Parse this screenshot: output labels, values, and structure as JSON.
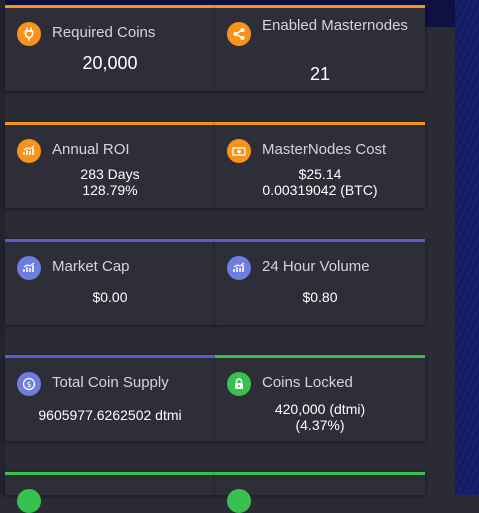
{
  "cards": [
    {
      "title": "Required Coins",
      "value": "20,000",
      "icon": "plug-icon",
      "accent": "#f7931a"
    },
    {
      "title": "Enabled Masternodes",
      "value": "21",
      "icon": "share-icon",
      "accent": "#f7931a"
    },
    {
      "title": "Annual ROI",
      "value_line1": "283 Days",
      "value_line2": "128.79%",
      "icon": "chart-up-icon",
      "accent": "#f7931a"
    },
    {
      "title": "MasterNodes Cost",
      "value_line1": "$25.14",
      "value_line2": "0.00319042 (BTC)",
      "icon": "money-icon",
      "accent": "#f7931a"
    },
    {
      "title": "Market Cap",
      "value": "$0.00",
      "icon": "chart-up-icon",
      "accent": "#5b5bcf"
    },
    {
      "title": "24 Hour Volume",
      "value": "$0.80",
      "icon": "chart-up-icon",
      "accent": "#5b5bcf"
    },
    {
      "title": "Total Coin Supply",
      "value": "9605977.6262502 dtmi",
      "icon": "dollar-coin-icon",
      "accent": "#5b5bcf"
    },
    {
      "title": "Coins Locked",
      "value_line1": "420,000 (dtmi)",
      "value_line2": "(4.37%)",
      "icon": "lock-icon",
      "accent": "#39c14f"
    }
  ]
}
